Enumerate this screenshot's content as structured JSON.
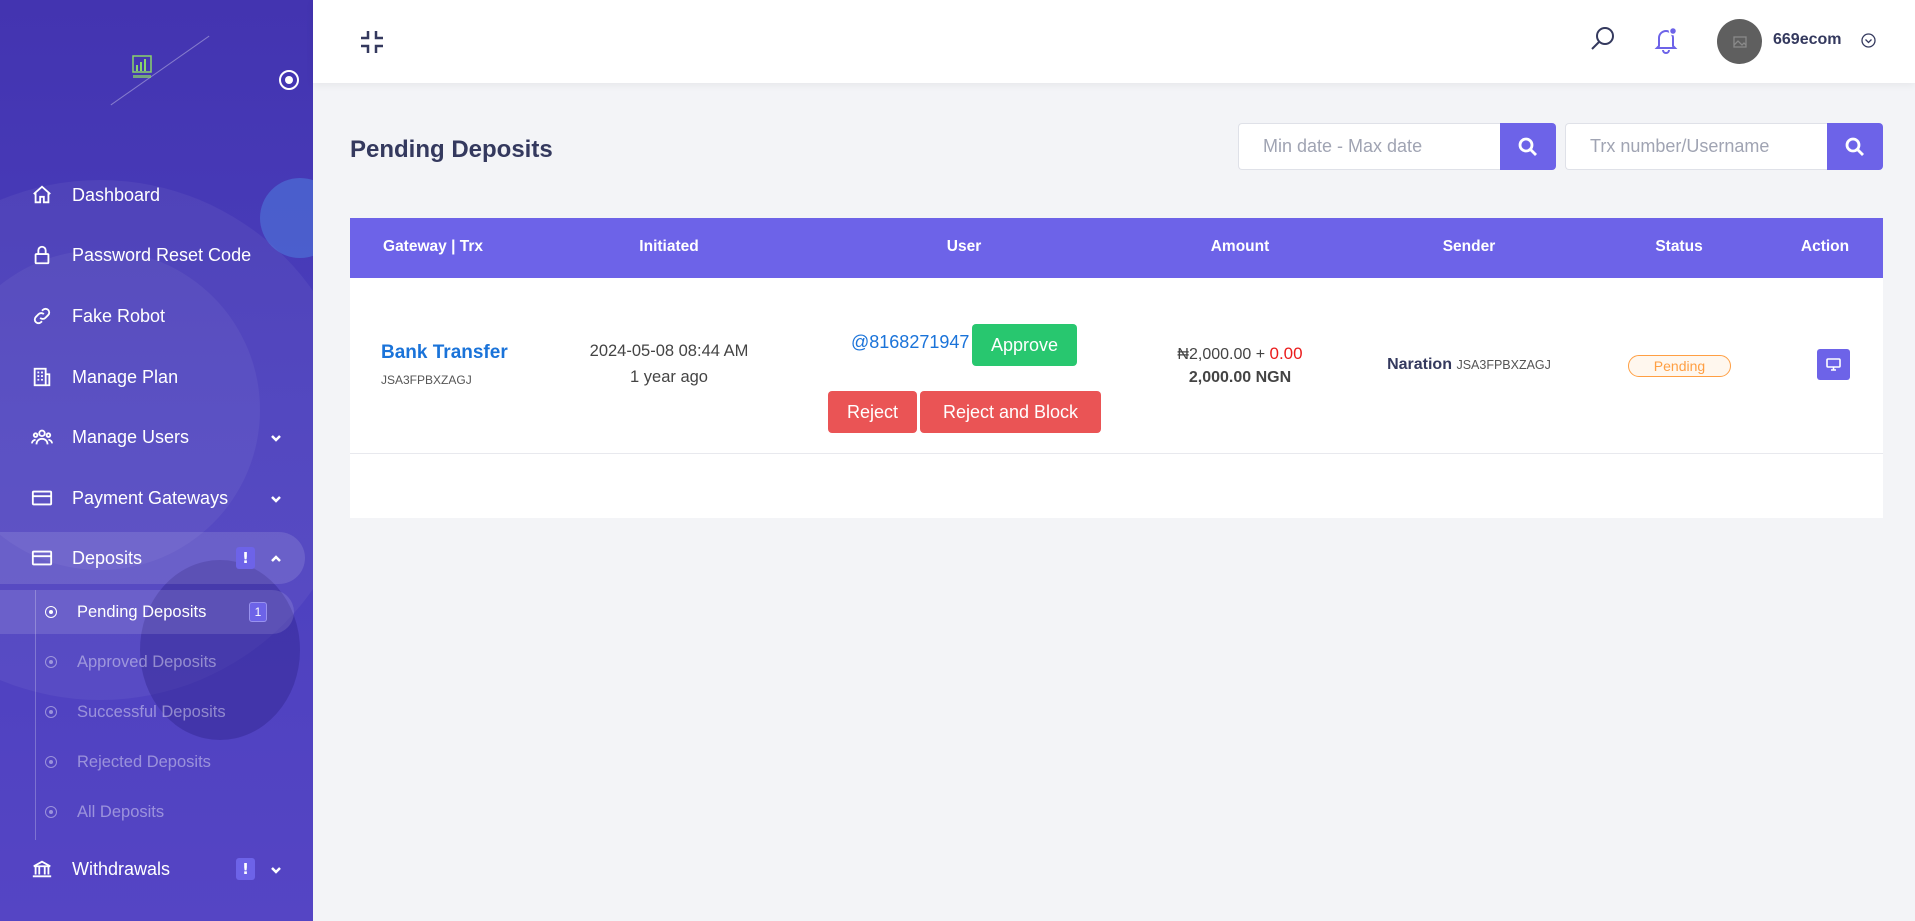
{
  "sidebar": {
    "menu": {
      "dashboard": "Dashboard",
      "password_reset": "Password Reset Code",
      "fake_robot": "Fake Robot",
      "manage_plan": "Manage Plan",
      "manage_users": "Manage Users",
      "payment_gateways": "Payment Gateways",
      "deposits": "Deposits",
      "withdrawals": "Withdrawals"
    },
    "alert_badge": "!",
    "deposit_submenu": {
      "pending": "Pending Deposits",
      "pending_count": "1",
      "approved": "Approved Deposits",
      "successful": "Successful Deposits",
      "rejected": "Rejected Deposits",
      "all": "All Deposits"
    }
  },
  "topbar": {
    "username": "669ecom"
  },
  "page": {
    "title": "Pending Deposits",
    "date_filter_placeholder": "Min date - Max date",
    "search_placeholder": "Trx number/Username"
  },
  "table": {
    "headers": {
      "gateway": "Gateway | Trx",
      "initiated": "Initiated",
      "user": "User",
      "amount": "Amount",
      "sender": "Sender",
      "status": "Status",
      "action": "Action"
    },
    "rows": [
      {
        "gateway": "Bank Transfer",
        "trx": "JSA3FPBXZAGJ",
        "initiated_date": "2024-05-08 08:44 AM",
        "initiated_ago": "1 year ago",
        "user": "@8168271947",
        "approve_label": "Approve",
        "reject_label": "Reject",
        "reject_block_label": "Reject and Block",
        "amount_base": "₦2,000.00 + ",
        "amount_charge": "0.00",
        "amount_total": "2,000.00 NGN",
        "sender_label": "Naration",
        "sender_ref": "JSA3FPBXZAGJ",
        "status": "Pending"
      }
    ]
  },
  "colors": {
    "primary": "#6d63e8",
    "sidebar": "#4334b0",
    "success": "#28c76f",
    "danger": "#ea5455",
    "warning": "#ff9f43",
    "link": "#1a73d9"
  }
}
